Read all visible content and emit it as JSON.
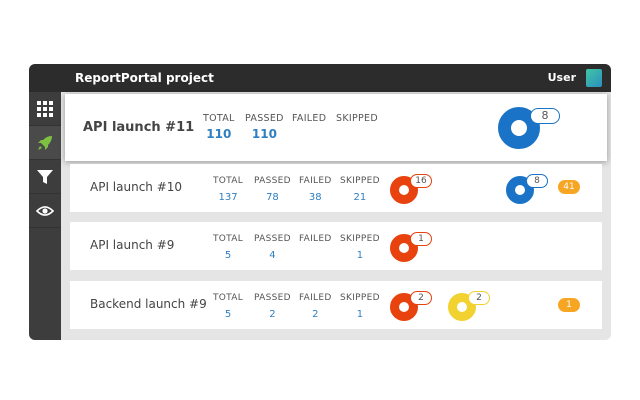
{
  "header": {
    "project_title": "ReportPortal project",
    "user_label": "User"
  },
  "sidebar": [
    {
      "name": "grid-icon"
    },
    {
      "name": "rocket-icon"
    },
    {
      "name": "filter-icon"
    },
    {
      "name": "eye-icon"
    }
  ],
  "stat_labels": {
    "total": "TOTAL",
    "passed": "PASSED",
    "failed": "FAILED",
    "skipped": "SKIPPED"
  },
  "launches": [
    {
      "name": "API launch #11",
      "total": "110",
      "passed": "110",
      "failed": "",
      "skipped": "",
      "defects": [
        {
          "type": "automation-bug",
          "color": "#1a73c7",
          "count": "8"
        }
      ],
      "badge": ""
    },
    {
      "name": "API launch #10",
      "total": "137",
      "passed": "78",
      "failed": "38",
      "skipped": "21",
      "defects": [
        {
          "type": "product-bug",
          "color": "#e8420f",
          "count": "16"
        },
        {
          "type": "automation-bug",
          "color": "#1a73c7",
          "count": "8"
        }
      ],
      "badge": "41"
    },
    {
      "name": "API launch #9",
      "total": "5",
      "passed": "4",
      "failed": "",
      "skipped": "1",
      "defects": [
        {
          "type": "product-bug",
          "color": "#e8420f",
          "count": "1"
        }
      ],
      "badge": ""
    },
    {
      "name": "Backend launch #9",
      "total": "5",
      "passed": "2",
      "failed": "2",
      "skipped": "1",
      "defects": [
        {
          "type": "product-bug",
          "color": "#e8420f",
          "count": "2"
        },
        {
          "type": "system-issue",
          "color": "#f2d230",
          "count": "2"
        }
      ],
      "badge": "1"
    }
  ],
  "colors": {
    "accent_blue": "#2f7fc1",
    "product_bug": "#e8420f",
    "automation_bug": "#1a73c7",
    "system_issue": "#f2d230",
    "to_investigate": "#f6a623"
  }
}
